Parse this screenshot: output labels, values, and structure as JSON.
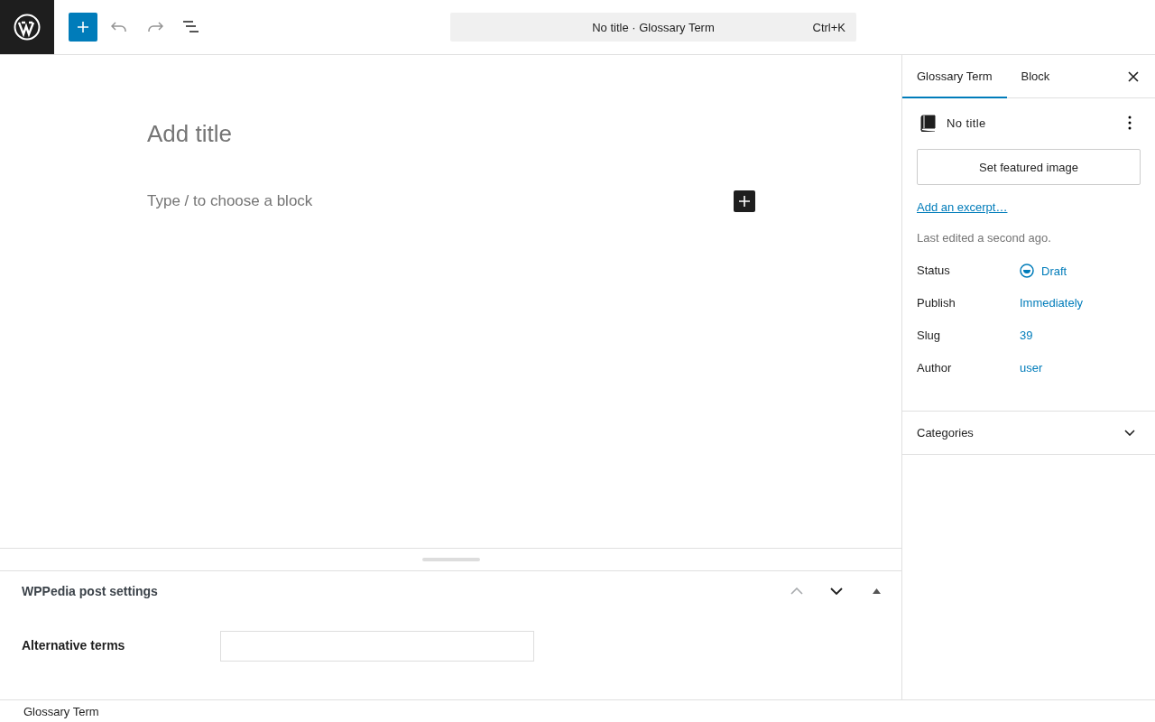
{
  "toolbar": {
    "undo_disabled": true,
    "redo_disabled": true
  },
  "command_bar": {
    "title": "No title · Glossary Term",
    "shortcut": "Ctrl+K"
  },
  "editor": {
    "title_placeholder": "Add title",
    "block_placeholder": "Type / to choose a block"
  },
  "metabox": {
    "title": "WPPedia post settings",
    "move_up_disabled": true,
    "fields": [
      {
        "label": "Alternative terms"
      }
    ]
  },
  "footer": {
    "breadcrumb": "Glossary Term"
  },
  "sidebar": {
    "tabs": [
      {
        "label": "Glossary Term",
        "selected": true
      },
      {
        "label": "Block",
        "selected": false
      }
    ],
    "post_title": "No title",
    "featured_button": "Set featured image",
    "excerpt_link": "Add an excerpt…",
    "last_edited": "Last edited a second ago.",
    "rows": [
      {
        "label": "Status",
        "value": "Draft",
        "kind": "status"
      },
      {
        "label": "Publish",
        "value": "Immediately",
        "kind": "link"
      },
      {
        "label": "Slug",
        "value": "39",
        "kind": "link"
      },
      {
        "label": "Author",
        "value": "user",
        "kind": "link"
      }
    ],
    "panels": [
      {
        "label": "Categories",
        "expanded": false
      }
    ]
  }
}
